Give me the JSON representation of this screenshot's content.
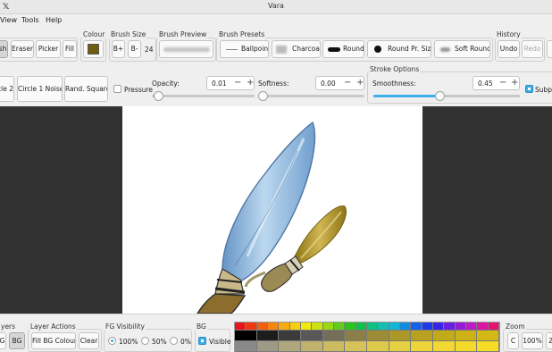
{
  "window": {
    "title": "Vara"
  },
  "menu": {
    "items": [
      "View",
      "Tools",
      "Help"
    ]
  },
  "tools": {
    "label_colour": "Colour",
    "label_brush_size": "Brush Size",
    "label_brush_preview": "Brush Preview",
    "label_brush_presets": "Brush Presets",
    "label_history": "History",
    "buttons": [
      "sh",
      "Eraser",
      "Picker",
      "Fill"
    ],
    "colour": "#6e5e0c",
    "brush_size_inc": "B+",
    "brush_size_dec": "B-",
    "brush_size_value": "24",
    "presets": [
      "Ballpoint",
      "Charcoal",
      "Round",
      "Round Pr. Size",
      "Soft Round"
    ],
    "undo": "Undo",
    "redo": "Redo"
  },
  "brush_shapes": [
    "cle 2",
    "Circle 1 Noise",
    "Rand. Square"
  ],
  "stroke": {
    "pressure_label": "Pressure",
    "opacity_label": "Opacity:",
    "opacity_value": "0.01",
    "opacity_fraction": 0.01,
    "softness_label": "Softness:",
    "softness_value": "0.00",
    "softness_fraction": 0.0,
    "options_label": "Stroke Options",
    "smoothness_label": "Smoothness:",
    "smoothness_value": "0.45",
    "smoothness_fraction": 0.45,
    "subpixel_label": "Subpix"
  },
  "bottom": {
    "layers_label": "yers",
    "layer_buttons": [
      "G",
      "BG"
    ],
    "layer_actions_label": "Layer Actions",
    "fill_bg_label": "Fill BG Colour",
    "clear_label": "Clear",
    "fg_visibility_label": "FG Visibility",
    "fg_options": [
      "100%",
      "50%",
      "0%"
    ],
    "bg_label": "BG",
    "visible_label": "Visible",
    "zoom_label": "Zoom",
    "zoom_buttons": [
      "C",
      "100%",
      "Z"
    ]
  },
  "palette": {
    "row1": [
      "#e8131b",
      "#ee3a12",
      "#f2600f",
      "#f5860d",
      "#f8ab0c",
      "#f9cf0b",
      "#f2e90c",
      "#cce20f",
      "#9ad812",
      "#5fcd19",
      "#2bc41f",
      "#11c04a",
      "#10c07e",
      "#11c0b1",
      "#12b6d6",
      "#138ce0",
      "#1661e8",
      "#1c3aec",
      "#3a22e8",
      "#6a1ee0",
      "#951cd6",
      "#bd19c8",
      "#db16a6",
      "#e61470"
    ],
    "row2": [
      "#000000",
      "#1d1d1d",
      "#3b3b3b",
      "#585858",
      "#756f5a",
      "#8a7f47",
      "#9c8c36",
      "#ab9829",
      "#b8a121",
      "#c3aa1a",
      "#cdb216",
      "#d4b815"
    ],
    "row3": [
      "#8a8a8a",
      "#9e9a86",
      "#b0a77c",
      "#bfb26f",
      "#ccbb62",
      "#d6c258",
      "#dfc94d",
      "#e7cf44",
      "#edd43b",
      "#f1d833",
      "#f4da2c",
      "#f6dc26"
    ]
  }
}
